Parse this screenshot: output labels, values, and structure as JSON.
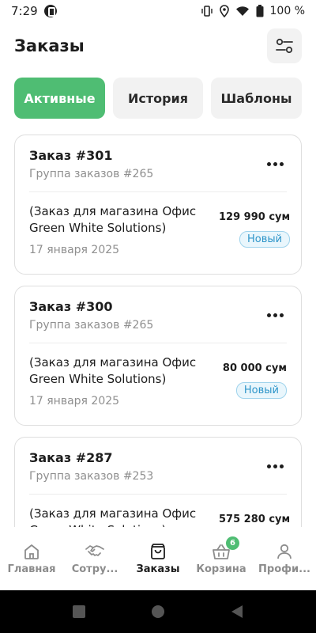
{
  "status_bar": {
    "time": "7:29",
    "battery": "100 %"
  },
  "header": {
    "title": "Заказы"
  },
  "tabs": [
    {
      "label": "Активные"
    },
    {
      "label": "История"
    },
    {
      "label": "Шаблоны"
    }
  ],
  "orders": [
    {
      "title": "Заказ #301",
      "group": "Группа заказов #265",
      "shop": "(Заказ для магазина Офис Green White Solutions)",
      "date": "17 января 2025",
      "price": "129 990 сум",
      "status": "Новый"
    },
    {
      "title": "Заказ #300",
      "group": "Группа заказов #265",
      "shop": "(Заказ для магазина Офис Green White Solutions)",
      "date": "17 января 2025",
      "price": "80 000 сум",
      "status": "Новый"
    },
    {
      "title": "Заказ #287",
      "group": "Группа заказов #253",
      "shop": "(Заказ для магазина Офис Green White Solutions)",
      "date": "",
      "price": "575 280 сум",
      "status": ""
    }
  ],
  "bottom_nav": [
    {
      "label": "Главная",
      "icon": "home-icon"
    },
    {
      "label": "Сотру...",
      "icon": "handshake-icon"
    },
    {
      "label": "Заказы",
      "icon": "shopping-bag-icon"
    },
    {
      "label": "Корзина",
      "icon": "basket-icon",
      "badge": "6"
    },
    {
      "label": "Профи...",
      "icon": "user-icon"
    }
  ],
  "colors": {
    "accent": "#4fbd73",
    "badge_text": "#2e95c9",
    "badge_bg": "#e9f6fc"
  }
}
